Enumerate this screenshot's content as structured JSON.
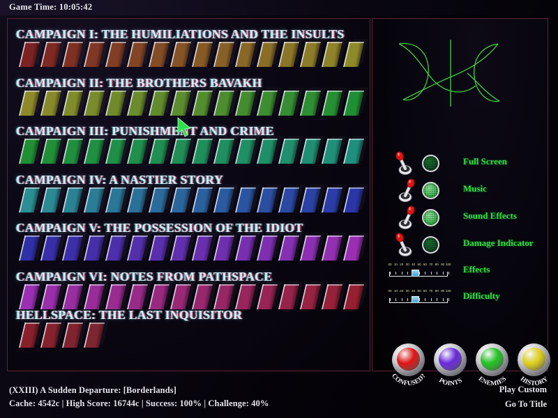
{
  "header": {
    "game_time_label": "Game Time:  10:05:42"
  },
  "campaigns": [
    {
      "title": "CAMPAIGN I: THE HUMILIATIONS AND THE INSULTS",
      "levels": 16,
      "color_start": "#7d2222",
      "color_end": "#8f8a28"
    },
    {
      "title": "CAMPAIGN II: THE BROTHERS BAVAKH",
      "levels": 16,
      "color_start": "#8f8a28",
      "color_end": "#1f8f33"
    },
    {
      "title": "CAMPAIGN III: PUNISHMENT AND CRIME",
      "levels": 16,
      "color_start": "#1f8f33",
      "color_end": "#1f8f7d"
    },
    {
      "title": "CAMPAIGN IV: A NASTIER STORY",
      "levels": 16,
      "color_start": "#2a8f92",
      "color_end": "#2a36a8"
    },
    {
      "title": "CAMPAIGN V: THE POSSESSION OF THE IDIOT",
      "levels": 16,
      "color_start": "#2f2fa8",
      "color_end": "#9b2fb4"
    },
    {
      "title": "CAMPAIGN VI: NOTES FROM PATHSPACE",
      "levels": 16,
      "color_start": "#9b2fb4",
      "color_end": "#962030"
    },
    {
      "title": "HELLSPACE: THE LAST INQUISITOR",
      "levels": 4,
      "color_start": "#8a1f2c",
      "color_end": "#7d2530"
    }
  ],
  "options": {
    "toggles": [
      {
        "label": "Full Screen",
        "state": "off"
      },
      {
        "label": "Music",
        "state": "on"
      },
      {
        "label": "Sound Effects",
        "state": "on"
      },
      {
        "label": "Damage Indicator",
        "state": "off"
      }
    ],
    "sliders": [
      {
        "label": "Effects",
        "value": 45,
        "min": 0,
        "max": 100,
        "ticks": [
          "00",
          "10",
          "20",
          "30",
          "40",
          "50",
          "60",
          "70",
          "80",
          "90",
          "100"
        ]
      },
      {
        "label": "Difficulty",
        "value": 45,
        "min": 0,
        "max": 100,
        "ticks": [
          "00",
          "10",
          "20",
          "30",
          "40",
          "50",
          "60",
          "70",
          "80",
          "90",
          "100"
        ]
      }
    ],
    "round_buttons": [
      {
        "label": "CONFUSED?",
        "color": "#e01414"
      },
      {
        "label": "POINTS",
        "color": "#6a28e0"
      },
      {
        "label": "ENEMIES",
        "color": "#22c422"
      },
      {
        "label": "HISTORY",
        "color": "#e0d018"
      }
    ]
  },
  "status": {
    "level_line": "(XXIII) A Sudden Departure: [Borderlands]",
    "stats_line": "Cache: 4542c | High Score: 16744c | Success: 100% | Challenge: 40%"
  },
  "menu": {
    "play_custom": "Play Custom",
    "go_to_title": "Go To Title"
  },
  "theme": {
    "accent_green": "#33dd44",
    "panel_border": "#5d2636",
    "title_text": "#cfeff6"
  }
}
